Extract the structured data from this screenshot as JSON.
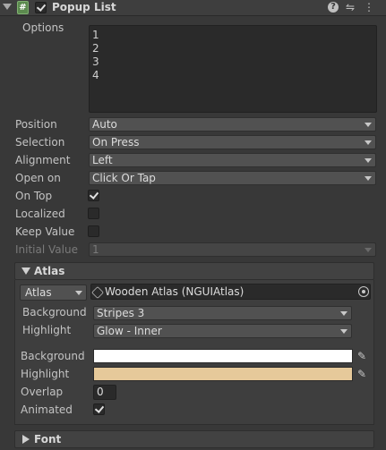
{
  "header": {
    "title": "Popup List",
    "enabled": true,
    "script_icon_glyph": "#",
    "icons": [
      "help-icon",
      "preset-icon",
      "kebab-menu-icon"
    ]
  },
  "options": {
    "label": "Options",
    "lines": [
      "1",
      "2",
      "3",
      "4"
    ]
  },
  "fields": {
    "position": {
      "label": "Position",
      "value": "Auto"
    },
    "selection": {
      "label": "Selection",
      "value": "On Press"
    },
    "alignment": {
      "label": "Alignment",
      "value": "Left"
    },
    "open_on": {
      "label": "Open on",
      "value": "Click Or Tap"
    },
    "on_top": {
      "label": "On Top",
      "checked": true
    },
    "localized": {
      "label": "Localized",
      "checked": false
    },
    "keep_value": {
      "label": "Keep Value",
      "checked": false
    },
    "initial_value": {
      "label": "Initial Value",
      "value": "1",
      "disabled": true
    }
  },
  "atlas_section": {
    "title": "Atlas",
    "expanded": true,
    "atlas_type": "Atlas",
    "atlas_value": "Wooden Atlas (NGUIAtlas)",
    "background_sprite": {
      "label": "Background",
      "value": "Stripes 3"
    },
    "highlight_sprite": {
      "label": "Highlight",
      "value": "Glow - Inner"
    },
    "background_color": {
      "label": "Background",
      "color": "#ffffff"
    },
    "highlight_color": {
      "label": "Highlight",
      "color": "#e6c99a"
    },
    "overlap": {
      "label": "Overlap",
      "value": "0"
    },
    "animated": {
      "label": "Animated",
      "checked": true
    }
  },
  "font_section": {
    "title": "Font",
    "expanded": false
  },
  "colors": {
    "background": "#383838",
    "field": "#515151",
    "text": "#c4c4c4"
  }
}
